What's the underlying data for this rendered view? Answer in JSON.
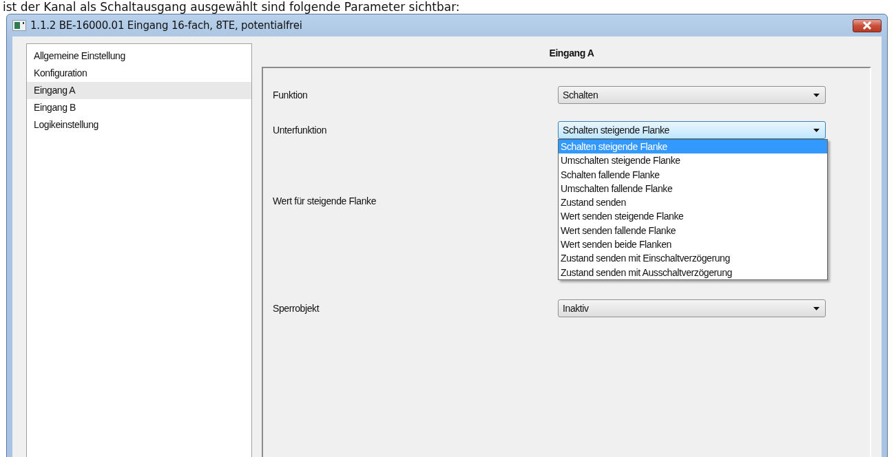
{
  "caption": "ist der Kanal als Schaltausgang ausgewählt sind folgende Parameter sichtbar:",
  "window": {
    "title": "1.1.2 BE-16000.01 Eingang 16-fach, 8TE, potentialfrei"
  },
  "sidebar": {
    "items": [
      {
        "label": "Allgemeine Einstellung",
        "selected": false
      },
      {
        "label": "Konfiguration",
        "selected": false
      },
      {
        "label": "Eingang A",
        "selected": true
      },
      {
        "label": "Eingang B",
        "selected": false
      },
      {
        "label": "Logikeinstellung",
        "selected": false
      }
    ]
  },
  "panel": {
    "title": "Eingang A",
    "parameters": [
      {
        "label": "Funktion",
        "value": "Schalten",
        "expanded": false
      },
      {
        "label": "Unterfunktion",
        "value": "Schalten steigende Flanke",
        "expanded": true,
        "options": [
          {
            "label": "Schalten steigende Flanke",
            "selected": true
          },
          {
            "label": "Umschalten steigende Flanke",
            "selected": false
          },
          {
            "label": "Schalten fallende Flanke",
            "selected": false
          },
          {
            "label": "Umschalten fallende Flanke",
            "selected": false
          },
          {
            "label": "Zustand senden",
            "selected": false
          },
          {
            "label": "Wert senden steigende Flanke",
            "selected": false
          },
          {
            "label": "Wert senden fallende Flanke",
            "selected": false
          },
          {
            "label": "Wert senden beide Flanken",
            "selected": false
          },
          {
            "label": "Zustand senden mit Einschaltverzögerung",
            "selected": false
          },
          {
            "label": "Zustand senden mit Ausschaltverzögerung",
            "selected": false
          }
        ]
      },
      {
        "label": "Wert für steigende Flanke"
      },
      {
        "label": "Sperrobjekt",
        "value": "Inaktiv",
        "expanded": false
      }
    ]
  }
}
